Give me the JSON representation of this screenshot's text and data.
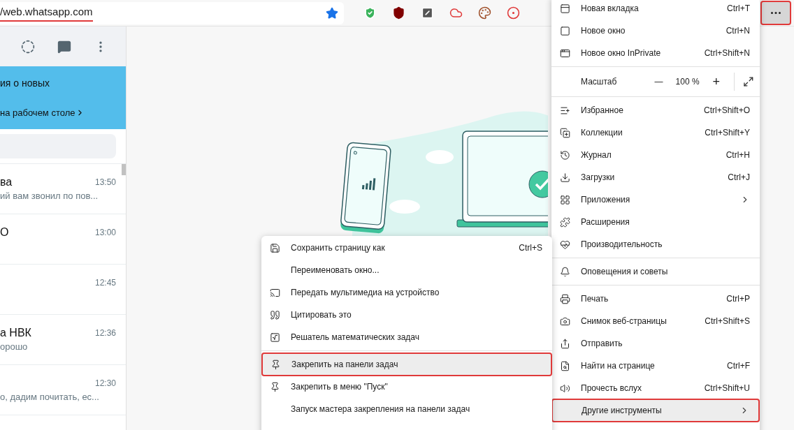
{
  "address_bar": {
    "url": "/web.whatsapp.com",
    "underlined": true
  },
  "more_button": {
    "highlighted": true
  },
  "sidebar": {
    "banner": {
      "line_1": "ия о новых",
      "link": "на рабочем столе"
    },
    "chats": [
      {
        "name": "ва",
        "time": "13:50",
        "preview": "ий вам звонил по пов..."
      },
      {
        "name": "О",
        "time": "13:00"
      },
      {
        "time": "12:45"
      },
      {
        "name": "а НВК",
        "time": "12:36",
        "preview": "орошо"
      },
      {
        "time": "12:30",
        "preview": "о, дадим почитать, ес..."
      }
    ]
  },
  "menu": {
    "items": [
      {
        "kind": "item",
        "label": "Новая вкладка",
        "shortcut": "Ctrl+T",
        "highlighted": false
      },
      {
        "kind": "item",
        "label": "Новое окно",
        "shortcut": "Ctrl+N",
        "highlighted": false
      },
      {
        "kind": "item",
        "label": "Новое окно InPrivate",
        "shortcut": "Ctrl+Shift+N",
        "highlighted": false
      },
      {
        "kind": "separator"
      },
      {
        "kind": "zoom",
        "label": "Масштаб",
        "minus": "—",
        "value": "100 %",
        "plus": "+"
      },
      {
        "kind": "separator"
      },
      {
        "kind": "item",
        "label": "Избранное",
        "shortcut": "Ctrl+Shift+O",
        "highlighted": false
      },
      {
        "kind": "item",
        "label": "Коллекции",
        "shortcut": "Ctrl+Shift+Y",
        "highlighted": false
      },
      {
        "kind": "item",
        "label": "Журнал",
        "shortcut": "Ctrl+H",
        "highlighted": false
      },
      {
        "kind": "item",
        "label": "Загрузки",
        "shortcut": "Ctrl+J",
        "highlighted": false
      },
      {
        "kind": "submenu",
        "label": "Приложения",
        "highlighted": false
      },
      {
        "kind": "item",
        "label": "Расширения",
        "highlighted": false
      },
      {
        "kind": "item",
        "label": "Производительность",
        "highlighted": false
      },
      {
        "kind": "separator"
      },
      {
        "kind": "item",
        "label": "Оповещения и советы",
        "highlighted": false
      },
      {
        "kind": "separator"
      },
      {
        "kind": "item",
        "label": "Печать",
        "shortcut": "Ctrl+P",
        "highlighted": false
      },
      {
        "kind": "item",
        "label": "Снимок веб-страницы",
        "shortcut": "Ctrl+Shift+S",
        "highlighted": false
      },
      {
        "kind": "item",
        "label": "Отправить",
        "highlighted": false
      },
      {
        "kind": "item",
        "label": "Найти на странице",
        "shortcut": "Ctrl+F",
        "highlighted": false
      },
      {
        "kind": "item",
        "label": "Прочесть вслух",
        "shortcut": "Ctrl+Shift+U",
        "highlighted": false
      },
      {
        "kind": "submenu",
        "label": "Другие инструменты",
        "highlighted": true
      }
    ]
  },
  "submenu": {
    "items": [
      {
        "kind": "item",
        "label": "Сохранить страницу как",
        "shortcut": "Ctrl+S",
        "highlighted": false
      },
      {
        "kind": "item",
        "label": "Переименовать окно...",
        "highlighted": false
      },
      {
        "kind": "item",
        "label": "Передать мультимедиа на устройство",
        "highlighted": false
      },
      {
        "kind": "item",
        "label": "Цитировать это",
        "highlighted": false
      },
      {
        "kind": "item",
        "label": "Решатель математических задач",
        "highlighted": false
      },
      {
        "kind": "separator"
      },
      {
        "kind": "item",
        "label": "Закрепить на панели задач",
        "highlighted": true
      },
      {
        "kind": "item",
        "label": "Закрепить в меню \"Пуск\"",
        "highlighted": false
      },
      {
        "kind": "item",
        "label": "Запуск мастера закрепления на панели задач",
        "highlighted": false
      }
    ]
  }
}
